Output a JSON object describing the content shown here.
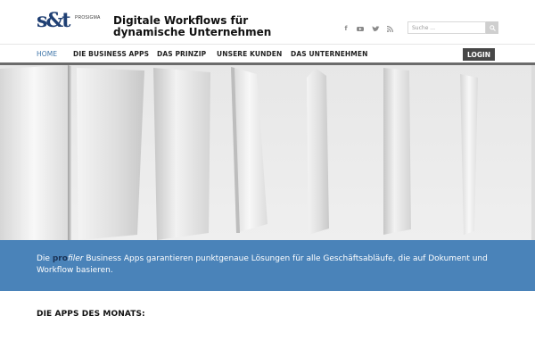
{
  "header": {
    "logo_text": "s&t",
    "logo_sub": "PROSIGMA",
    "tagline_line1": "Digitale Workflows für",
    "tagline_line2": "dynamische Unternehmen",
    "social": [
      "facebook-icon",
      "youtube-icon",
      "twitter-icon",
      "rss-icon"
    ],
    "search": {
      "placeholder": "Suche ..."
    }
  },
  "nav": {
    "items": [
      {
        "label": "HOME",
        "active": true
      },
      {
        "label": "DIE BUSINESS APPS"
      },
      {
        "label": "DAS PRINZIP"
      },
      {
        "label": "UNSERE KUNDEN"
      },
      {
        "label": "DAS UNTERNEHMEN"
      }
    ],
    "login_label": "LOGIN"
  },
  "band": {
    "prefix": "Die ",
    "brand_pro": "pro",
    "brand_filer": "filer",
    "text": " Business Apps garantieren punktgenaue Lösungen für alle Geschäftsabläufe, die auf Dokument und Workflow basieren."
  },
  "apps_heading": "DIE APPS DES MONATS:",
  "colors": {
    "brand_blue": "#1f3f73",
    "band_blue": "#4a83b9",
    "nav_active": "#3c74a8",
    "login_bg": "#474747"
  }
}
